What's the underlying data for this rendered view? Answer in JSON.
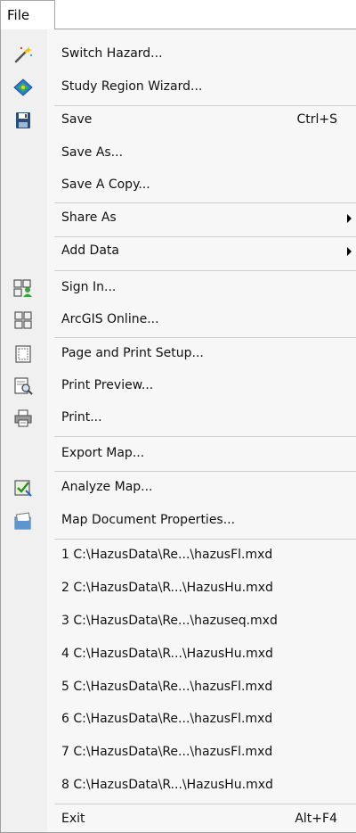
{
  "file_tab": {
    "label": "File"
  },
  "menu": {
    "switch_hazard": {
      "label": "Switch Hazard...",
      "icon": "magic-wand-icon"
    },
    "study_region_wizard": {
      "label": "Study Region Wizard...",
      "icon": "study-region-icon"
    },
    "save": {
      "label": "Save",
      "shortcut": "Ctrl+S",
      "icon": "save-icon"
    },
    "save_as": {
      "label": "Save As..."
    },
    "save_a_copy": {
      "label": "Save A Copy..."
    },
    "share_as": {
      "label": "Share As"
    },
    "add_data": {
      "label": "Add Data"
    },
    "sign_in": {
      "label": "Sign In...",
      "icon": "sign-in-icon"
    },
    "arcgis_online": {
      "label": "ArcGIS Online...",
      "icon": "grid-icon"
    },
    "page_print_setup": {
      "label": "Page and Print Setup...",
      "icon": "page-setup-icon"
    },
    "print_preview": {
      "label": "Print Preview...",
      "icon": "print-preview-icon"
    },
    "print": {
      "label": "Print...",
      "icon": "printer-icon"
    },
    "export_map": {
      "label": "Export Map..."
    },
    "analyze_map": {
      "label": "Analyze Map...",
      "icon": "analyze-icon"
    },
    "map_doc_props": {
      "label": "Map Document Properties...",
      "icon": "properties-icon"
    },
    "recent": [
      "1 C:\\HazusData\\Re...\\hazusFl.mxd",
      "2 C:\\HazusData\\R...\\HazusHu.mxd",
      "3 C:\\HazusData\\Re...\\hazuseq.mxd",
      "4 C:\\HazusData\\R...\\HazusHu.mxd",
      "5 C:\\HazusData\\Re...\\hazusFl.mxd",
      "6 C:\\HazusData\\Re...\\hazusFl.mxd",
      "7 C:\\HazusData\\Re...\\hazusFl.mxd",
      "8 C:\\HazusData\\R...\\HazusHu.mxd"
    ],
    "exit": {
      "label": "Exit",
      "shortcut": "Alt+F4"
    }
  },
  "colors": {
    "menu_background": "#f7f7f7",
    "icon_column": "#f0f0f0",
    "separator": "#d0d0d0",
    "border": "#a0a0a0"
  }
}
